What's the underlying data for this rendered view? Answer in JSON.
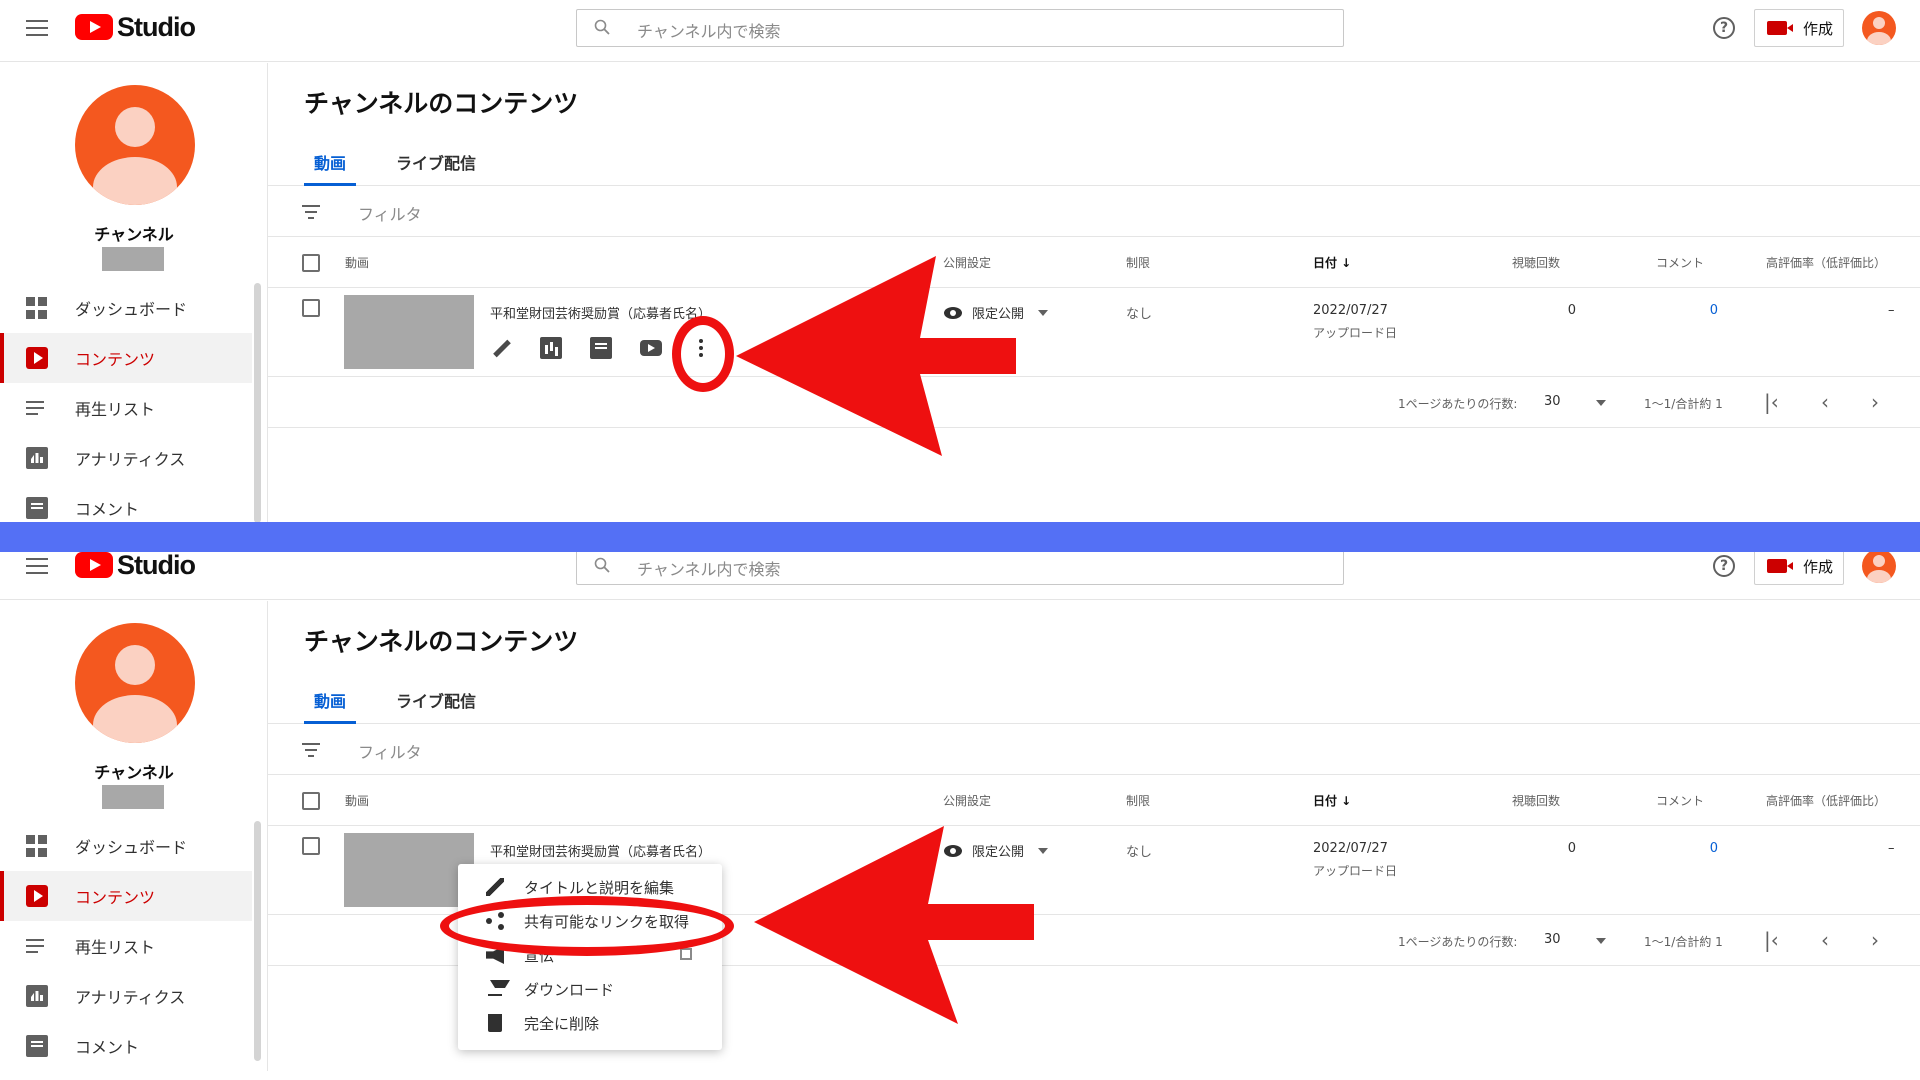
{
  "app": {
    "logo_text": "Studio",
    "accent": "#cc0000",
    "link": "#065fd4",
    "divider_color": "#5470f5"
  },
  "header": {
    "search_placeholder": "チャンネル内で検索",
    "help_glyph": "?",
    "create_label": "作成"
  },
  "sidebar": {
    "channel_name": "チャンネル",
    "items": [
      {
        "label": "ダッシュボード",
        "icon": "dashboard-icon"
      },
      {
        "label": "コンテンツ",
        "icon": "content-icon",
        "active": true
      },
      {
        "label": "再生リスト",
        "icon": "playlist-icon"
      },
      {
        "label": "アナリティクス",
        "icon": "analytics-icon"
      },
      {
        "label": "コメント",
        "icon": "comment-icon"
      }
    ]
  },
  "main": {
    "title": "チャンネルのコンテンツ",
    "tabs": [
      {
        "label": "動画",
        "active": true
      },
      {
        "label": "ライブ配信"
      }
    ],
    "filter_label": "フィルタ",
    "columns": {
      "video": "動画",
      "visibility": "公開設定",
      "restrictions": "制限",
      "date": "日付 ↓",
      "views": "視聴回数",
      "comments": "コメント",
      "ratio": "高評価率（低評価比）"
    },
    "row": {
      "title": "平和堂財団芸術奨励賞（応募者氏名）",
      "visibility": "限定公開",
      "restrictions": "なし",
      "date": "2022/07/27",
      "date_note": "アップロード日",
      "views": "0",
      "comments": "0",
      "ratio": "–"
    },
    "pagination": {
      "rows_per_page_label": "1ページあたりの行数:",
      "rows_per_page": "30",
      "range": "1～1/合計約 1",
      "first": "|‹",
      "prev": "‹",
      "next": "›"
    }
  },
  "menu": {
    "items": [
      {
        "label": "タイトルと説明を編集",
        "icon": "pencil-icon"
      },
      {
        "label": "共有可能なリンクを取得",
        "icon": "share-icon"
      },
      {
        "label": "宣伝",
        "icon": "megaphone-icon"
      },
      {
        "label": "ダウンロード",
        "icon": "download-icon"
      },
      {
        "label": "完全に削除",
        "icon": "trash-icon"
      }
    ]
  },
  "annotation": {
    "color": "#ee1010"
  }
}
